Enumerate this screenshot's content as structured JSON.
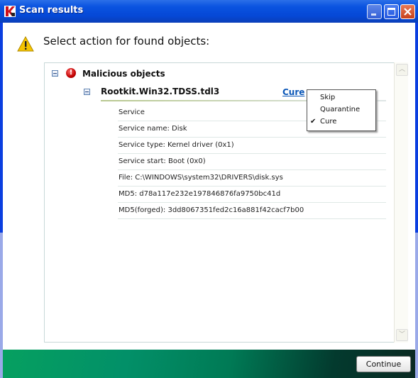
{
  "window": {
    "title": "Scan results",
    "app_icon": "kaspersky-k-icon",
    "controls": [
      "minimize",
      "maximize",
      "close"
    ]
  },
  "header": {
    "icon": "warning-icon",
    "text": "Select action for found objects:"
  },
  "tree": {
    "group": {
      "label": "Malicious objects",
      "icon": "error-icon",
      "expanded": true
    },
    "object": {
      "name": "Rootkit.Win32.TDSS.tdl3",
      "expanded": true,
      "action_label": "Cure",
      "details": [
        "Service",
        "Service name: Disk",
        "Service type: Kernel driver (0x1)",
        "Service start: Boot (0x0)",
        "File: C:\\WINDOWS\\system32\\DRIVERS\\disk.sys",
        "MD5: d78a117e232e197846876fa9750bc41d",
        "MD5(forged): 3dd8067351fed2c16a881f42cacf7b00"
      ]
    }
  },
  "action_menu": {
    "items": [
      {
        "label": "Skip",
        "checked": false
      },
      {
        "label": "Quarantine",
        "checked": false
      },
      {
        "label": "Cure",
        "checked": true
      }
    ],
    "check_glyph": "✔"
  },
  "footer": {
    "continue_label": "Continue"
  },
  "scrollbar": {
    "up": "︿",
    "down": "﹀"
  }
}
